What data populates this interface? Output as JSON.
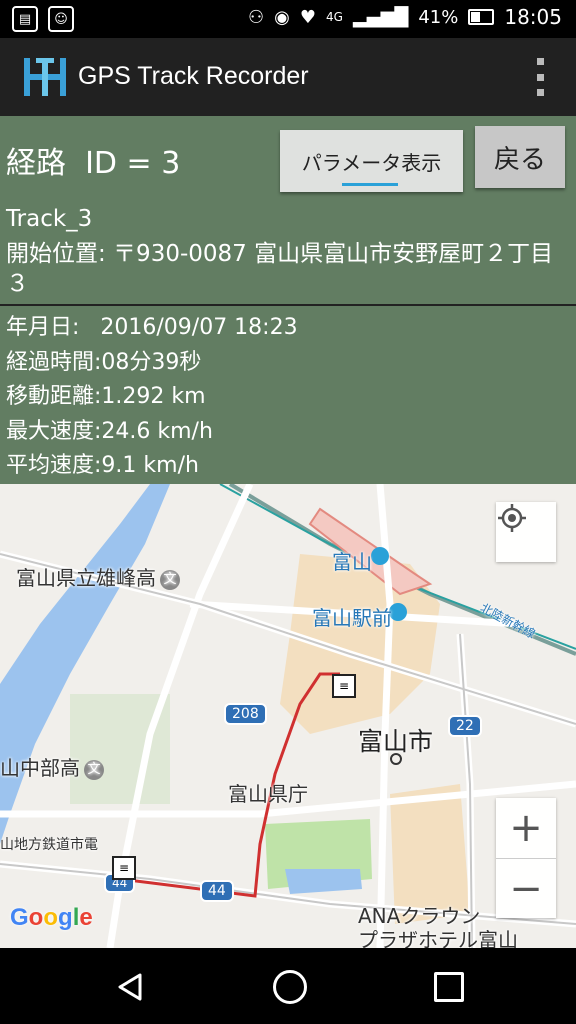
{
  "status_bar": {
    "battery": "41%",
    "time": "18:05",
    "network": "4G"
  },
  "app_bar": {
    "title": "GPS Track Recorder"
  },
  "route": {
    "title": "経路  ID = 3",
    "params_button": "パラメータ表示",
    "back_button": "戻る",
    "track_name": "Track_3",
    "start_position": "開始位置: 〒930-0087 富山県富山市安野屋町２丁目３"
  },
  "stats": {
    "date": "年月日:   2016/09/07 18:23",
    "elapsed": "経過時間:08分39秒",
    "distance": "移動距離:1.292 km",
    "max_speed": "最大速度:24.6 km/h",
    "avg_speed": "平均速度:9.1 km/h"
  },
  "map": {
    "labels": {
      "toyama_station": "富山",
      "toyama_ekimae": "富山駅前",
      "yuho_high": "富山県立雄峰高",
      "chubu_high": "山中部高",
      "toyama_city": "富山市",
      "pref_office": "富山県庁",
      "chiho_tetsudo": "山地方鉄道市電",
      "ana_hotel_1": "ANAクラウン",
      "ana_hotel_2": "プラザホテル富山",
      "shinkansen": "北陸新幹線"
    },
    "road_208": "208",
    "road_22": "22",
    "road_44a": "44",
    "road_44b": "44",
    "school_glyph": "文",
    "google": "Google",
    "zoom_in": "+",
    "zoom_out": "−"
  },
  "colors": {
    "panel_bg": "#627d62",
    "track_line": "#d03030",
    "app_bar_bg": "#212121"
  }
}
